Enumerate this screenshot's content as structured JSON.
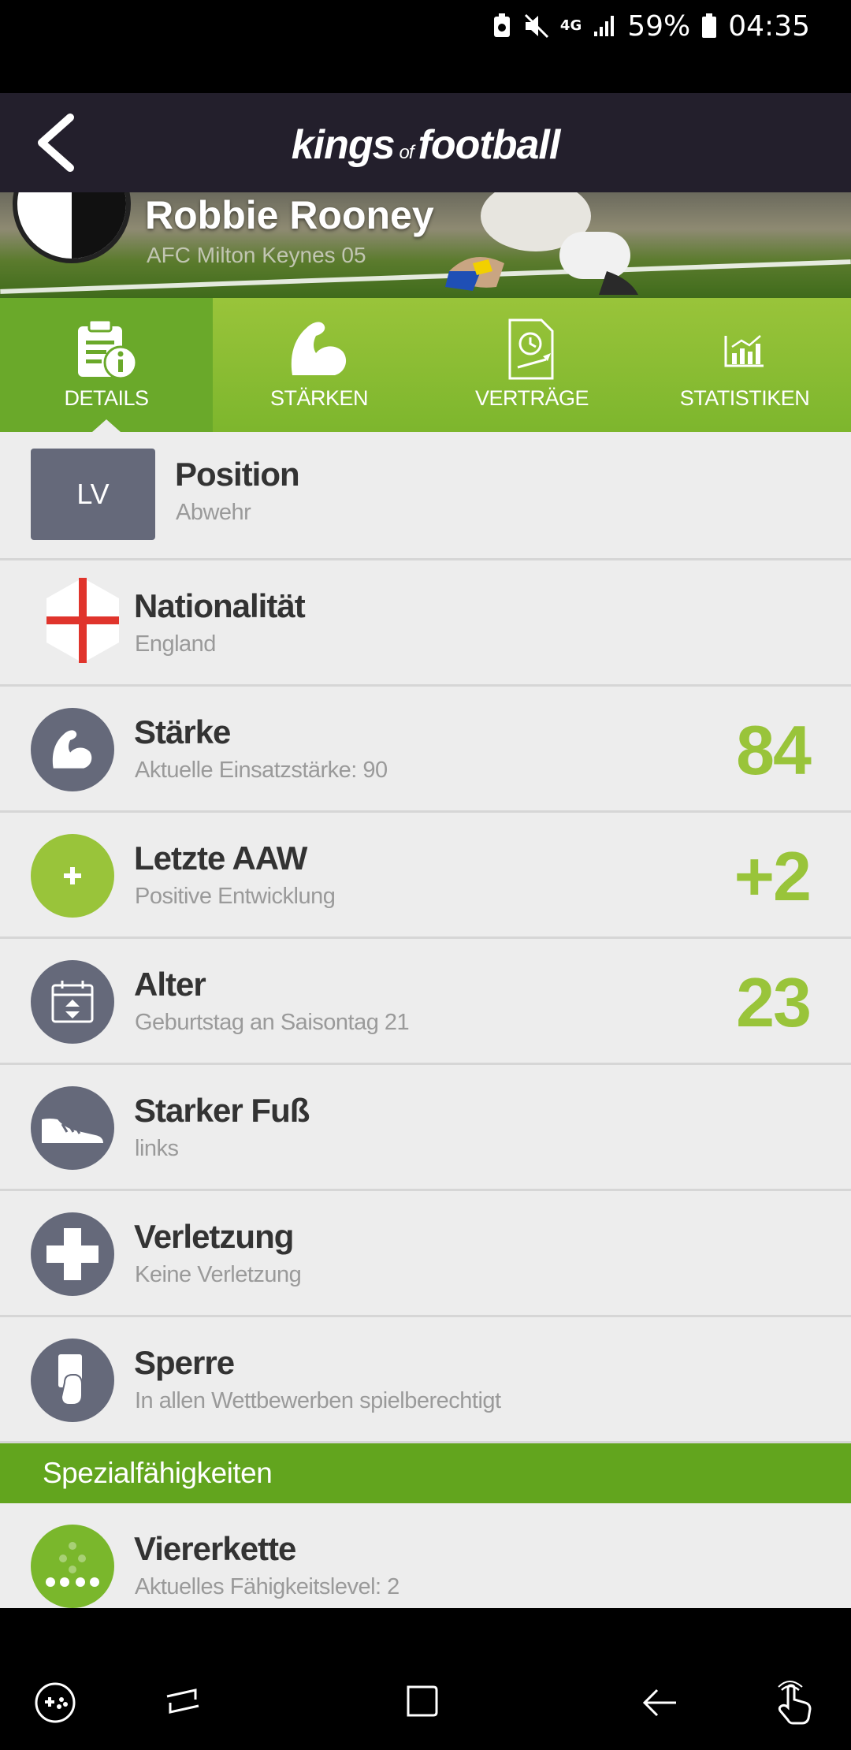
{
  "status_bar": {
    "network": "4G",
    "battery": "59%",
    "time": "04:35"
  },
  "header": {
    "logo_main_1": "kings",
    "logo_of": "of",
    "logo_main_2": "football"
  },
  "player": {
    "name": "Robbie Rooney",
    "club": "AFC Milton Keynes 05"
  },
  "tabs": [
    {
      "label": "DETAILS",
      "icon": "clipboard-info-icon",
      "active": true
    },
    {
      "label": "STÄRKEN",
      "icon": "bicep-icon"
    },
    {
      "label": "VERTRÄGE",
      "icon": "contract-clock-icon"
    },
    {
      "label": "STATISTIKEN",
      "icon": "bar-chart-icon"
    }
  ],
  "details": {
    "position": {
      "badge": "LV",
      "title": "Position",
      "sub": "Abwehr"
    },
    "nationality": {
      "title": "Nationalität",
      "sub": "England",
      "icon": "england-flag-icon"
    },
    "strength": {
      "title": "Stärke",
      "sub": "Aktuelle Einsatzstärke: 90",
      "value": "84",
      "icon": "bicep-icon"
    },
    "last_aaw": {
      "title": "Letzte AAW",
      "sub": "Positive Entwicklung",
      "value": "+2",
      "icon": "plus-icon"
    },
    "age": {
      "title": "Alter",
      "sub": "Geburtstag an Saisontag 21",
      "value": "23",
      "icon": "calendar-icon"
    },
    "foot": {
      "title": "Starker Fuß",
      "sub": "links",
      "icon": "boot-icon"
    },
    "injury": {
      "title": "Verletzung",
      "sub": "Keine Verletzung",
      "icon": "medical-cross-icon"
    },
    "suspension": {
      "title": "Sperre",
      "sub": "In allen Wettbewerben spielberechtigt",
      "icon": "referee-card-icon"
    }
  },
  "special": {
    "header": "Spezialfähigkeiten",
    "items": [
      {
        "title": "Viererkette",
        "sub": "Aktuelles Fähigkeitslevel: 2",
        "icon": "formation-dots-icon"
      }
    ]
  },
  "colors": {
    "accent_green": "#99c43a",
    "header_dark": "#231f2c",
    "icon_slate": "#65697a"
  }
}
